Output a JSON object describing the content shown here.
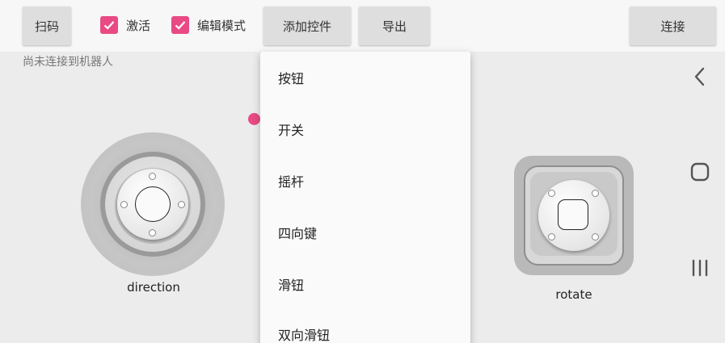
{
  "toolbar": {
    "scan_label": "扫码",
    "activate_label": "激活",
    "edit_mode_label": "编辑模式",
    "add_control_label": "添加控件",
    "export_label": "导出",
    "connect_label": "连接"
  },
  "status_text": "尚未连接到机器人",
  "joysticks": {
    "direction_label": "direction",
    "rotate_label": "rotate"
  },
  "menu": {
    "items": [
      {
        "label": "按钮"
      },
      {
        "label": "开关"
      },
      {
        "label": "摇杆"
      },
      {
        "label": "四向键"
      },
      {
        "label": "滑钮"
      },
      {
        "label": "双向滑钮"
      }
    ]
  },
  "nav": {
    "back_icon": "chevron-left-icon",
    "home_icon": "rounded-square-icon",
    "recents_icon": "three-bars-icon"
  },
  "colors": {
    "accent": "#e94a84",
    "button_bg": "#dedede",
    "background": "#ececec"
  }
}
